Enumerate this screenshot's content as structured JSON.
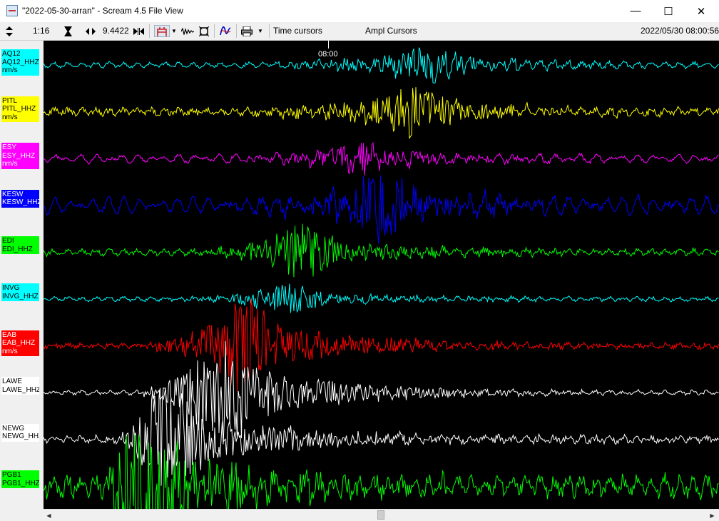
{
  "window": {
    "title": "\"2022-05-30-arran\" - Scream 4.5 File View",
    "minimize_glyph": "—",
    "maximize_glyph": "☐",
    "close_glyph": "✕"
  },
  "toolbar": {
    "time_scale": "1:16",
    "amplitude_scale": "9.4422",
    "time_cursors_label": "Time cursors",
    "ampl_cursors_label": "Ampl Cursors",
    "datetime": "2022/05/30 08:00:56",
    "icons": [
      "updown-arrows-icon",
      "hourglass-icon",
      "leftright-arrows-icon",
      "fit-width-icon",
      "pick-icon",
      "filter-wave-icon",
      "zoom-box-icon",
      "spectrum-icon",
      "printer-icon"
    ]
  },
  "plot": {
    "time_marker": "08:00",
    "background": "#000000"
  },
  "channels": [
    {
      "station": "AQ12",
      "component": "AQ12_HHZ",
      "units": "nm/s",
      "color": "#00ffff",
      "text_color": "#000000"
    },
    {
      "station": "PITL",
      "component": "PITL_HHZ",
      "units": "nm/s",
      "color": "#ffff00",
      "text_color": "#000000"
    },
    {
      "station": "ESY",
      "component": "ESY_HHZ",
      "units": "nm/s",
      "color": "#ff00ff",
      "text_color": "#ffffff"
    },
    {
      "station": "KESW",
      "component": "KESW_HHZ",
      "units": "",
      "color": "#0000ff",
      "text_color": "#ffffff"
    },
    {
      "station": "EDI",
      "component": "EDI_HHZ",
      "units": "",
      "color": "#00ff00",
      "text_color": "#000000"
    },
    {
      "station": "INVG",
      "component": "INVG_HHZ",
      "units": "",
      "color": "#00ffff",
      "text_color": "#000000"
    },
    {
      "station": "EAB",
      "component": "EAB_HHZ",
      "units": "nm/s",
      "color": "#ff0000",
      "text_color": "#ffffff"
    },
    {
      "station": "LAWE",
      "component": "LAWE_HHZ",
      "units": "",
      "color": "#ffffff",
      "text_color": "#000000"
    },
    {
      "station": "NEWG",
      "component": "NEWG_HHZ",
      "units": "",
      "color": "#ffffff",
      "text_color": "#000000"
    },
    {
      "station": "PGB1",
      "component": "PGB1_HHZ",
      "units": "",
      "color": "#00ff00",
      "text_color": "#000000"
    }
  ]
}
